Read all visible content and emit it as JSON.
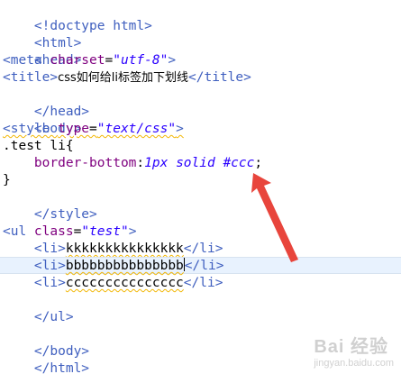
{
  "code": {
    "doctype": "<!doctype html>",
    "html_open": "<html>",
    "head_open": "<head>",
    "meta_pre": "<meta ",
    "meta_attr": "charset",
    "meta_eq": "=",
    "meta_val": "\"utf-8\"",
    "meta_close": ">",
    "title_open": "<title>",
    "title_text": "css如何给li标签加下划线",
    "title_close": "</title>",
    "head_close": "</head>",
    "body_open": "<body>",
    "style_pre": "<style ",
    "style_attr": "type",
    "style_eq": "=",
    "style_val": "\"text/css\"",
    "style_close_bracket": ">",
    "selector": ".test li{",
    "property": "border-bottom",
    "colon": ":",
    "value": "1px solid #ccc",
    "semicolon": ";",
    "brace_close": "}",
    "style_close": "</style>",
    "ul_pre": "<ul ",
    "ul_attr": "class",
    "ul_eq": "=",
    "ul_val": "\"test\"",
    "ul_close_bracket": ">",
    "li_open": "<li>",
    "li_close": "</li>",
    "li1": "kkkkkkkkkkkkkkk",
    "li2": "bbbbbbbbbbbbbbb",
    "li3": "ccccccccccccccc",
    "ul_close": "</ul>",
    "body_close": "</body>",
    "html_close": "</html>"
  },
  "colors": {
    "tag": "#3f5fbf",
    "attribute": "#7f007f",
    "string": "#2a00ff",
    "highlight_line": "#e8f2fe",
    "arrow": "#e8453c"
  },
  "watermark": {
    "brand": "Bai 经验",
    "url": "jingyan.baidu.com"
  }
}
